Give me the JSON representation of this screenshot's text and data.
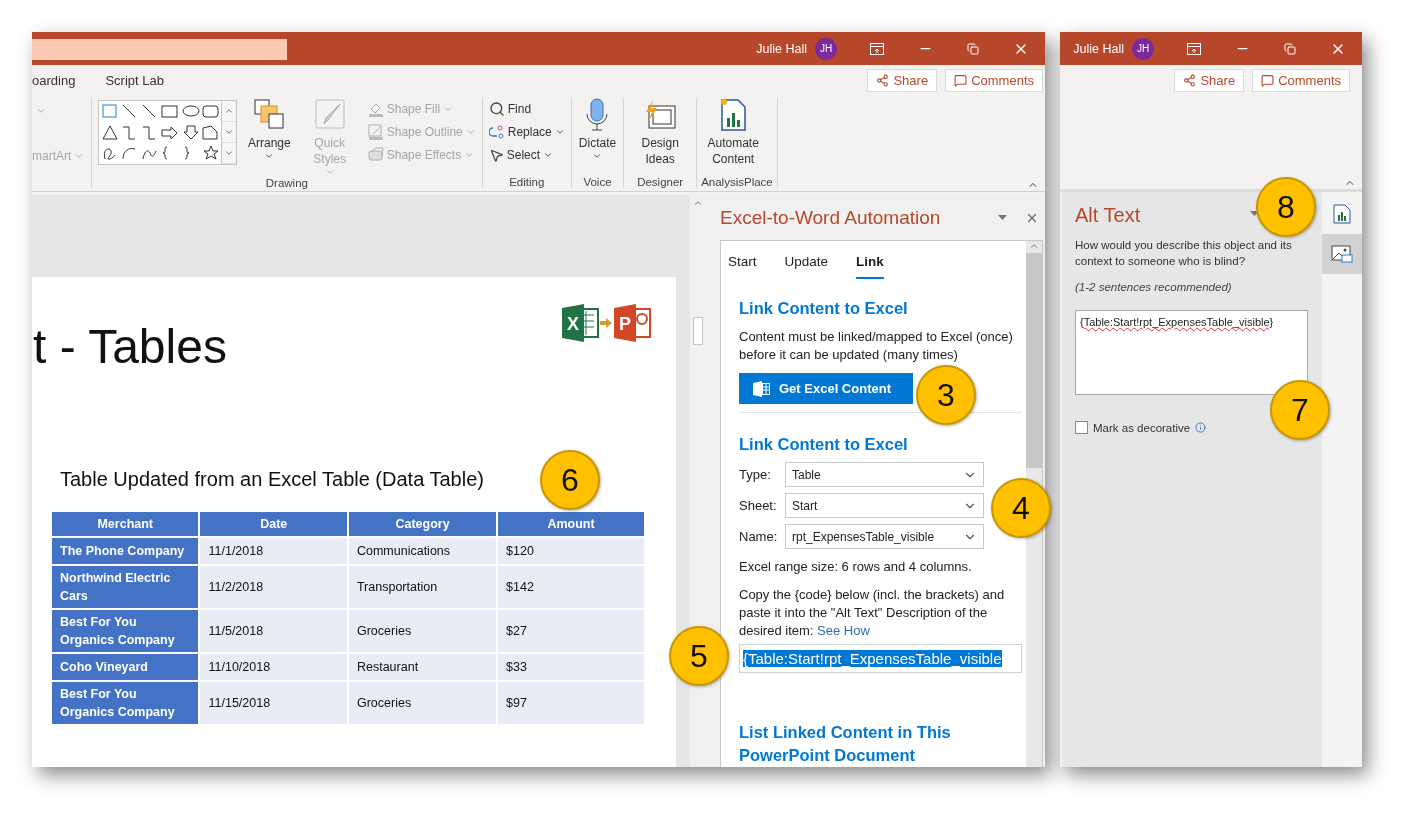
{
  "main_window": {
    "title_bar": {
      "user": "Julie Hall",
      "initials": "JH"
    },
    "ribbon_tabs": [
      "oarding",
      "Script Lab"
    ],
    "header_buttons": [
      {
        "kind": "share",
        "label": "Share"
      },
      {
        "kind": "comments",
        "label": "Comments"
      }
    ],
    "ribbon": {
      "partial_group": {
        "label": "martArt",
        "disabled": true
      },
      "groups": [
        {
          "name": "Drawing",
          "items": [
            {
              "kind": "gallery"
            },
            {
              "kind": "arrange",
              "label": "Arrange",
              "caret": true,
              "disabled": false
            },
            {
              "kind": "quick-styles",
              "label": "Quick Styles",
              "caret": true,
              "disabled": true
            },
            {
              "kind": "stack",
              "stack": [
                {
                  "kind": "shape-fill",
                  "label": "Shape Fill",
                  "caret": true,
                  "disabled": true
                },
                {
                  "kind": "shape-outline",
                  "label": "Shape Outline",
                  "caret": true,
                  "disabled": true
                },
                {
                  "kind": "shape-effects",
                  "label": "Shape Effects",
                  "caret": true,
                  "disabled": true
                }
              ]
            }
          ]
        },
        {
          "name": "Editing",
          "items": [
            {
              "kind": "stack",
              "stack": [
                {
                  "kind": "find",
                  "label": "Find",
                  "caret": false,
                  "disabled": false
                },
                {
                  "kind": "replace",
                  "label": "Replace",
                  "caret": true,
                  "disabled": false
                },
                {
                  "kind": "select",
                  "label": "Select",
                  "caret": true,
                  "disabled": false
                }
              ]
            }
          ]
        },
        {
          "name": "Voice",
          "items": [
            {
              "kind": "dictate",
              "label": "Dictate",
              "caret": true,
              "disabled": false
            }
          ]
        },
        {
          "name": "Designer",
          "items": [
            {
              "kind": "design-ideas",
              "label": "Design Ideas",
              "caret": false,
              "disabled": false
            }
          ]
        },
        {
          "name": "AnalysisPlace",
          "items": [
            {
              "kind": "automate",
              "label": "Automate Content",
              "caret": false,
              "disabled": false
            }
          ]
        }
      ]
    },
    "slide": {
      "title": "t - Tables",
      "logos": [
        {
          "kind": "excel",
          "letter": "X"
        },
        {
          "kind": "powerpoint",
          "letter": "P"
        }
      ],
      "table_title": "Table Updated from an Excel Table (Data Table)",
      "table": {
        "columns": [
          "Merchant",
          "Date",
          "Category",
          "Amount"
        ],
        "rows": [
          [
            "The Phone Company",
            "11/1/2018",
            "Communications",
            "$120"
          ],
          [
            "Northwind Electric Cars",
            "11/2/2018",
            "Transportation",
            "$142"
          ],
          [
            "Best For You Organics Company",
            "11/5/2018",
            "Groceries",
            "$27"
          ],
          [
            "Coho Vineyard",
            "11/10/2018",
            "Restaurant",
            "$33"
          ],
          [
            "Best For You Organics Company",
            "11/15/2018",
            "Groceries",
            "$97"
          ]
        ]
      }
    },
    "task_pane": {
      "title": "Excel-to-Word Automation",
      "tabs": [
        {
          "label": "Start",
          "selected": false
        },
        {
          "label": "Update",
          "selected": false
        },
        {
          "label": "Link",
          "selected": true
        }
      ],
      "heading_1": "Link Content to Excel",
      "intro": "Content must be linked/mapped to Excel (once) before it can be updated (many times)",
      "button": "Get Excel Content",
      "heading_2": "Link Content to Excel",
      "fields": [
        {
          "label": "Type:",
          "value": "Table"
        },
        {
          "label": "Sheet:",
          "value": "Start"
        },
        {
          "label": "Name:",
          "value": "rpt_ExpensesTable_visible"
        }
      ],
      "range_info": "Excel range size: 6 rows and 4 columns.",
      "instructions": "Copy the {code} below (incl. the brackets) and paste it into the \"Alt Text\" Description of the desired item:",
      "link": "See How",
      "code": {
        "value": "{Table:Start!rpt_ExpensesTable_visible",
        "selected": true
      },
      "heading_3": "List Linked Content in This PowerPoint Document"
    }
  },
  "alt_text_window": {
    "title_bar": {
      "user": "Julie Hall",
      "initials": "JH"
    },
    "header_buttons": [
      {
        "kind": "share",
        "label": "Share"
      },
      {
        "kind": "comments",
        "label": "Comments"
      }
    ],
    "pane": {
      "title": "Alt Text",
      "description": "How would you describe this object and its context to someone who is blind?",
      "hint": "(1-2 sentences recommended)",
      "text": "{Table:Start!rpt_ExpensesTable_visible}",
      "checkbox": {
        "label": "Mark as decorative",
        "checked": false
      }
    },
    "side_tabs": [
      {
        "kind": "add-in",
        "selected": false
      },
      {
        "kind": "alt-text",
        "selected": true
      }
    ]
  },
  "callouts": [
    {
      "label": "3"
    },
    {
      "label": "4"
    },
    {
      "label": "5"
    },
    {
      "label": "6"
    },
    {
      "label": "7"
    },
    {
      "label": "8"
    }
  ]
}
